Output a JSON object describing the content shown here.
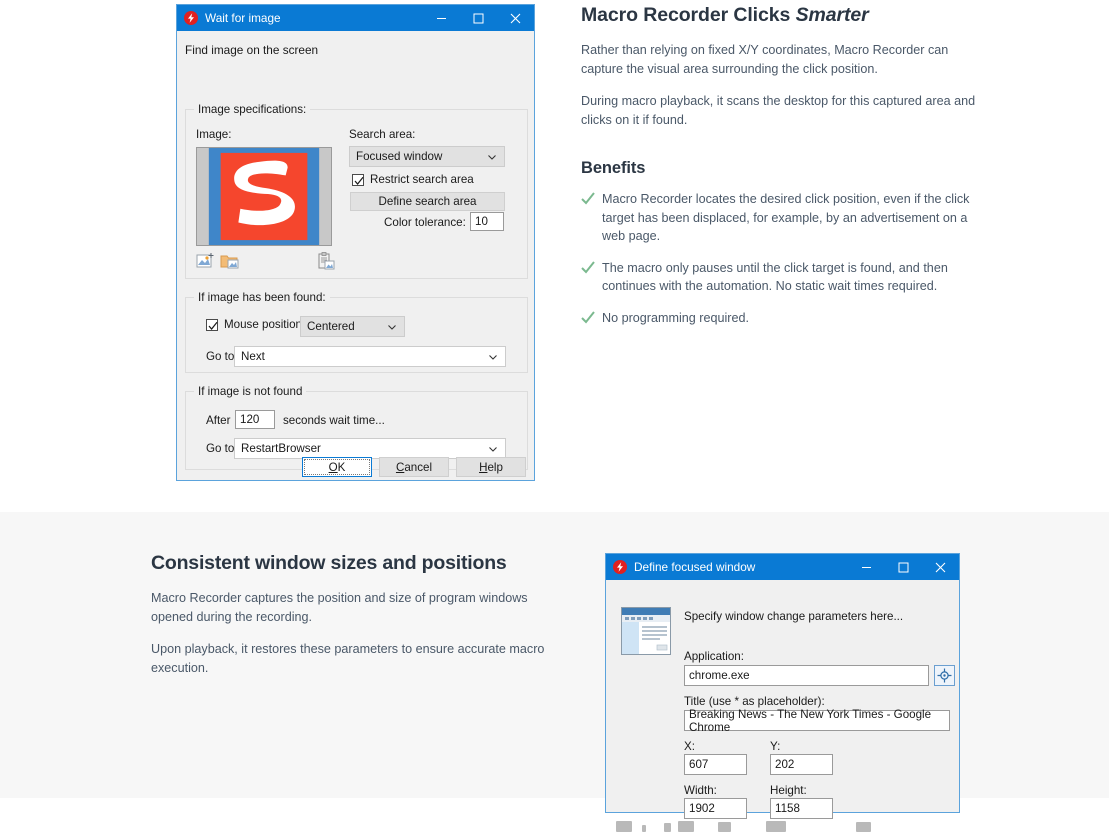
{
  "page": {
    "background_top": "#ffffff",
    "background_bottom": "#f7f7f7",
    "accent_blue": "#0a7ad4",
    "check_green": "#7bb98f",
    "heading_color": "#2b3643",
    "body_color": "#4a5868"
  },
  "hero": {
    "headline_main": "Macro Recorder Clicks ",
    "headline_italic": "Smarter",
    "paragraph_1": "Rather than relying on fixed X/Y coordinates, Macro Recorder can capture the visual area surrounding the click position.",
    "paragraph_2": "During macro playback, it scans the desktop for this captured area and clicks on it if found.",
    "benefits_heading": "Benefits",
    "benefits": [
      "Macro Recorder locates the desired click position, even if the click target has been displaced, for example, by an advertisement on a web page.",
      "The macro only pauses until the click target is found, and then continues with the automation. No static wait times required.",
      "No programming required."
    ]
  },
  "section_two": {
    "heading": "Consistent window sizes and positions",
    "paragraph_1": "Macro Recorder captures the position and size of program windows opened during the recording.",
    "paragraph_2": "Upon playback, it restores these parameters to ensure accurate macro execution."
  },
  "wait_dialog": {
    "title": "Wait for image",
    "app_icon": "macro-recorder-bolt-icon",
    "window_controls": [
      "minimize-icon",
      "maximize-icon",
      "close-icon"
    ],
    "hint": "Find image on the screen",
    "image_group": {
      "legend": "Image specifications:",
      "image_label": "Image:",
      "thumbnail_alt": "captured-screen-region-red-s-logo",
      "toolbar_icons": [
        "add-image-icon",
        "open-image-folder-icon",
        "paste-from-clipboard-icon"
      ]
    },
    "search_area": {
      "label": "Search area:",
      "value": "Focused window",
      "restrict_checkbox_label": "Restrict search area",
      "restrict_checked": true,
      "define_button": "Define search area",
      "color_tolerance_label": "Color tolerance:",
      "color_tolerance_value": "10"
    },
    "found_group": {
      "legend": "If image has been found:",
      "mouse_position_label": "Mouse position:",
      "mouse_position_checked": true,
      "mouse_position_value": "Centered",
      "goto_label": "Go to",
      "goto_value": "Next"
    },
    "not_found_group": {
      "legend": "If image is not found",
      "after_label": "After",
      "after_value": "120",
      "seconds_label": "seconds wait time...",
      "goto_label": "Go to",
      "goto_value": "RestartBrowser"
    },
    "buttons": {
      "ok": {
        "prefix": "",
        "accel": "O",
        "suffix": "K"
      },
      "cancel": {
        "prefix": "",
        "accel": "C",
        "suffix": "ancel"
      },
      "help": {
        "prefix": "",
        "accel": "H",
        "suffix": "elp"
      }
    }
  },
  "focus_dialog": {
    "title": "Define focused window",
    "app_icon": "macro-recorder-bolt-icon",
    "window_controls": [
      "minimize-icon",
      "maximize-icon",
      "close-icon"
    ],
    "hint": "Specify window change parameters here...",
    "illustration_alt": "browser-window-illustration",
    "application_label": "Application:",
    "application_value": "chrome.exe",
    "picker_icon": "crosshair-target-icon",
    "title_label": "Title (use * as placeholder):",
    "title_value": "Breaking News - The New York Times - Google Chrome",
    "x_label": "X:",
    "x_value": "607",
    "y_label": "Y:",
    "y_value": "202",
    "width_label": "Width:",
    "width_value": "1902",
    "height_label": "Height:",
    "height_value": "1158"
  }
}
